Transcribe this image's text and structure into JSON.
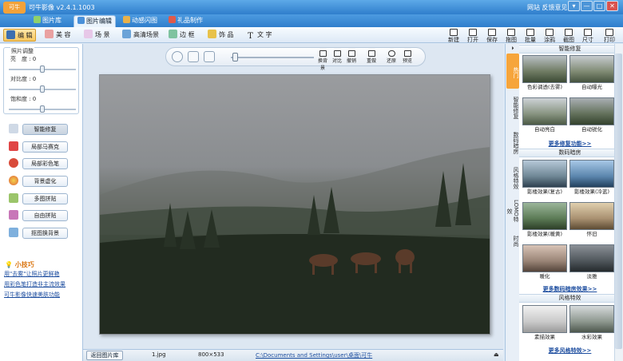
{
  "app": {
    "title": "可牛影像 v2.4.1.1003",
    "logo_text": "可牛",
    "links": "网站 反馈意见"
  },
  "window_buttons": [
    "▾",
    "—",
    "□",
    "✕"
  ],
  "tabs": [
    {
      "label": "图片库"
    },
    {
      "label": "图片编辑"
    },
    {
      "label": "动感闪图"
    },
    {
      "label": "礼品制作"
    }
  ],
  "tools": [
    {
      "label": "编 辑"
    },
    {
      "label": "美 容"
    },
    {
      "label": "场 景"
    },
    {
      "label": "高清场景"
    },
    {
      "label": "边 框"
    },
    {
      "label": "饰 品"
    },
    {
      "label": "文 字"
    }
  ],
  "right_tools": [
    "新建",
    "打开",
    "保存",
    "拖图",
    "批量",
    "涂鸦",
    "截图",
    "尺寸",
    "打印"
  ],
  "adjust": {
    "title": "照片调整",
    "brightness": "亮　度 : 0",
    "contrast": "对比度 : 0",
    "saturation": "饱和度 : 0",
    "levels": [
      0.5,
      0.5,
      0.5
    ]
  },
  "left_buttons": [
    "智能修复",
    "局部马赛克",
    "局部彩色笔",
    "背景虚化",
    "多图拼贴",
    "自由拼贴",
    "抠图换背景"
  ],
  "tips": {
    "title": "小技巧",
    "lines": [
      "用\"去雾\"让照片更鲜艳",
      "用彩色笔打造非主流效果",
      "可牛影像快速美肤功能"
    ]
  },
  "float_toolbar": {
    "labels": [
      "换背景",
      "对比",
      "撤销",
      "重做",
      "还原",
      "预览"
    ],
    "zoom": 0.05
  },
  "status": {
    "back": "返回图片库",
    "file": "1.jpg",
    "size": "800×533",
    "path": "C:\\Documents and Settings\\user\\桌面\\可牛"
  },
  "vtabs": [
    "热门",
    "智能修复",
    "数码暗房",
    "风格特效",
    "LOMO特效",
    "时尚"
  ],
  "sections": [
    {
      "title": "智能修复",
      "items": [
        "色彩调透(去雾)",
        "自动曝光",
        "自动亮白",
        "自动锐化"
      ],
      "more": "更多修复功能>>"
    },
    {
      "title": "数码暗房",
      "items": [
        "影楼效果(复古)",
        "影楼效果(冷蓝)",
        "影楼效果(暖黄)",
        "怀旧",
        "暖化",
        "淡雅"
      ],
      "more": "更多数码暗房效果>>"
    },
    {
      "title": "风格特效",
      "items": [
        "素描效果",
        "水彩效果"
      ],
      "more": "更多风格特效>>"
    }
  ],
  "colors": {
    "accent": "#2f7ecc",
    "active_tab": "#f6a53b",
    "link": "#1f4fa0"
  }
}
